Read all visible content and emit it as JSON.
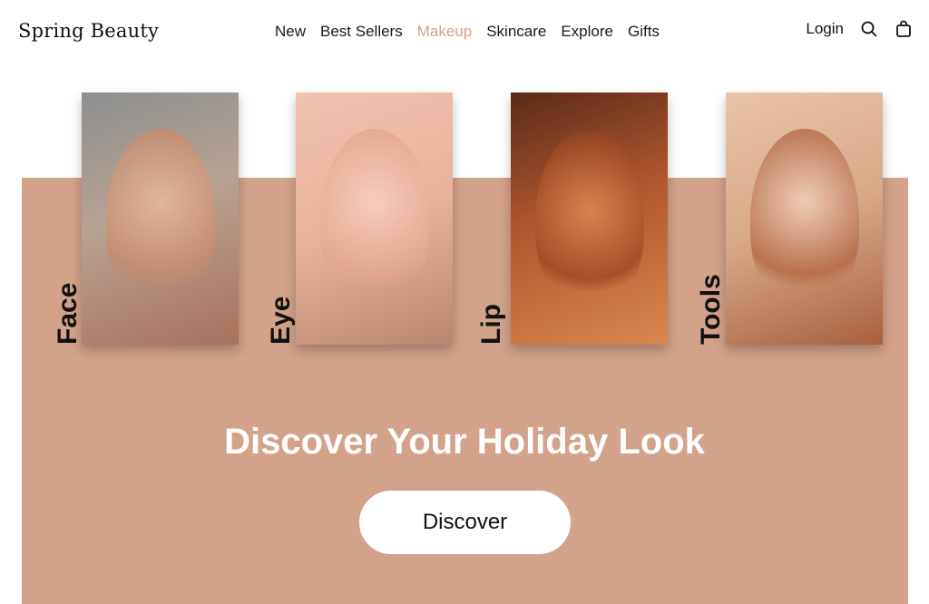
{
  "brand": "Spring Beauty",
  "nav": {
    "items": [
      "New",
      "Best Sellers",
      "Makeup",
      "Skincare",
      "Explore",
      "Gifts"
    ],
    "active": "Makeup"
  },
  "header_actions": {
    "login": "Login",
    "search_icon": "search-icon",
    "bag_icon": "shopping-bag-icon"
  },
  "hero": {
    "categories": [
      "Face",
      "Eye",
      "Lip",
      "Tools"
    ],
    "headline": "Discover Your Holiday Look",
    "cta": "Discover",
    "colors": {
      "band": "#d3a28a",
      "nav_active": "#d3a28a",
      "headline": "#ffffff",
      "cta_bg": "#ffffff"
    }
  }
}
